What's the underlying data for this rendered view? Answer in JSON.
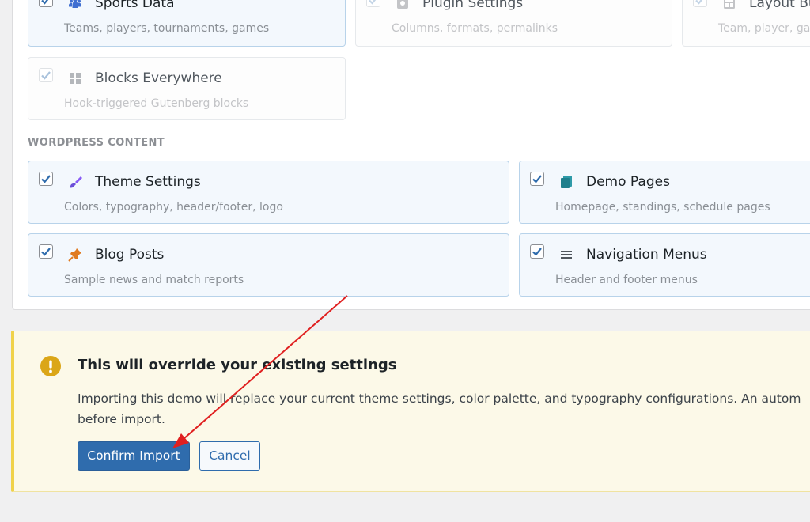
{
  "plugin_cards": [
    {
      "title": "Sports Data",
      "desc": "Teams, players, tournaments, games",
      "checked": true
    },
    {
      "title": "Plugin Settings",
      "desc": "Columns, formats, permalinks",
      "checked": true
    },
    {
      "title": "Layout Bu",
      "desc": "Team, player, gan",
      "checked": true
    },
    {
      "title": "Blocks Everywhere",
      "desc": "Hook-triggered Gutenberg blocks",
      "checked": true
    }
  ],
  "section_label": "WORDPRESS CONTENT",
  "content_cards": [
    {
      "title": "Theme Settings",
      "desc": "Colors, typography, header/footer, logo",
      "checked": true
    },
    {
      "title": "Demo Pages",
      "desc": "Homepage, standings, schedule pages",
      "checked": true
    },
    {
      "title": "Blog Posts",
      "desc": "Sample news and match reports",
      "checked": true
    },
    {
      "title": "Navigation Menus",
      "desc": "Header and footer menus",
      "checked": true
    }
  ],
  "notice": {
    "title": "This will override your existing settings",
    "body": "Importing this demo will replace your current theme settings, color palette, and typography configurations. An autom before import.",
    "confirm_label": "Confirm Import",
    "cancel_label": "Cancel"
  },
  "colors": {
    "accent": "#2f6cad",
    "warning": "#dba617",
    "annotation_arrow": "#e02020"
  },
  "icons": {
    "sports_data": "people-icon",
    "plugin_settings": "settings-box-icon",
    "layout_builder": "layout-icon",
    "blocks_everywhere": "grid-icon",
    "theme_settings": "paintbrush-icon",
    "demo_pages": "pages-icon",
    "blog_posts": "pushpin-icon",
    "navigation_menus": "menu-icon",
    "warning": "exclamation-icon"
  }
}
